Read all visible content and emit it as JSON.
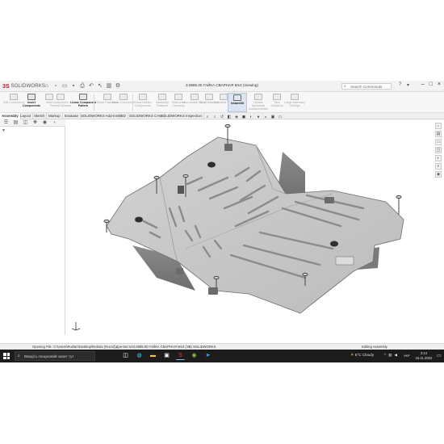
{
  "app": {
    "logo_ds": "3S",
    "logo_name": "SOLIDWORKS",
    "document_title": "3.0885.00 ГАЙКА СВАРНАЯ М10 (Viewing)",
    "search_placeholder": "Search Commands"
  },
  "quick_access": [
    "new-icon",
    "open-icon",
    "save-icon",
    "print-icon",
    "undo-icon",
    "select-icon",
    "rebuild-icon",
    "options-icon"
  ],
  "commands": [
    {
      "label": "Edit Component",
      "enabled": false
    },
    {
      "label": "Insert Components",
      "enabled": true
    },
    {
      "label": "Mate",
      "enabled": false
    },
    {
      "label": "Component Preview Window",
      "enabled": false
    },
    {
      "label": "Linear Component Pattern",
      "enabled": true
    },
    {
      "label": "Smart Fasteners",
      "enabled": false
    },
    {
      "label": "Move Component",
      "enabled": false
    },
    {
      "label": "Show Hidden Components",
      "enabled": false
    },
    {
      "label": "Assembly Features",
      "enabled": false
    },
    {
      "label": "Reference Geometry",
      "enabled": false
    },
    {
      "label": "New Motion Study",
      "enabled": false
    },
    {
      "label": "Bill of Materials",
      "enabled": false
    },
    {
      "label": "Exploded View",
      "enabled": false
    },
    {
      "label": "Instant3D",
      "enabled": true,
      "selected": true
    },
    {
      "label": "Update Speedpak Subassemblies",
      "enabled": false
    },
    {
      "label": "Take Snapshot",
      "enabled": false
    },
    {
      "label": "Large Assembly Settings",
      "enabled": false
    }
  ],
  "tabs": [
    "Assembly",
    "Layout",
    "Sketch",
    "Markup",
    "Evaluate",
    "SOLIDWORKS Add-Ins",
    "MBD",
    "SOLIDWORKS CAM",
    "SOLIDWORKS Inspection"
  ],
  "active_tab": "Assembly",
  "status": {
    "message": "Opening File: C:\\Users\\Ruslan\\Desktop\\Robota (Rocni)\\Дон-Кости\\3.0885.00 ГАЙКА СВАРНАЯ М10 (ЭВ) SOLIDWORKS",
    "right": "Editing Assembly"
  },
  "taskbar": {
    "search_text": "Введіть пошуковий запит тут",
    "weather": "5°C  Cloudy",
    "language": "УКР",
    "time": "3:14",
    "date": "16.11.2022"
  }
}
